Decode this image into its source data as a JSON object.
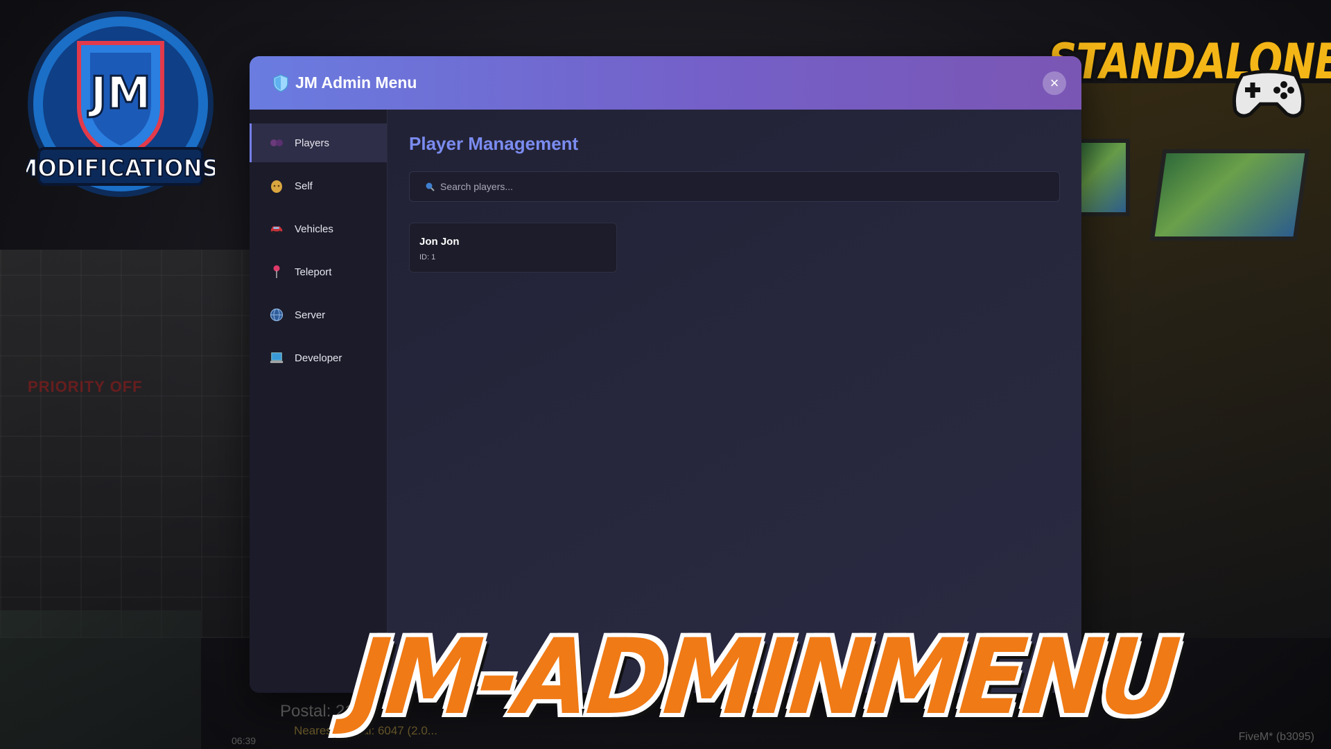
{
  "window": {
    "title": "JM Admin Menu",
    "close_label": "×"
  },
  "sidebar": {
    "items": [
      {
        "label": "Players",
        "icon": "people-icon",
        "active": true
      },
      {
        "label": "Self",
        "icon": "face-icon",
        "active": false
      },
      {
        "label": "Vehicles",
        "icon": "car-icon",
        "active": false
      },
      {
        "label": "Teleport",
        "icon": "pin-icon",
        "active": false
      },
      {
        "label": "Server",
        "icon": "globe-icon",
        "active": false
      },
      {
        "label": "Developer",
        "icon": "laptop-icon",
        "active": false
      }
    ]
  },
  "main": {
    "heading": "Player Management",
    "search_placeholder": "Search players...",
    "players": [
      {
        "name": "Jon Jon",
        "id_label": "ID: 1"
      }
    ]
  },
  "overlay": {
    "logo_top": "JM",
    "logo_bottom": "MODIFICATIONS",
    "badge": "STANDALONE",
    "banner": "JM-ADMINMENU"
  },
  "hud": {
    "priority": "PRIORITY OFF",
    "postal": "Postal: 217",
    "nearest_postal": "Nearest Postal: 6047 (2.0...",
    "time": "06:39",
    "client": "FiveM* (b3095)"
  },
  "colors": {
    "accent": "#7b8cf0",
    "header_start": "#6a7ce0",
    "header_end": "#7a56b4",
    "banner_orange": "#f07a15",
    "badge_yellow": "#f4b617"
  }
}
